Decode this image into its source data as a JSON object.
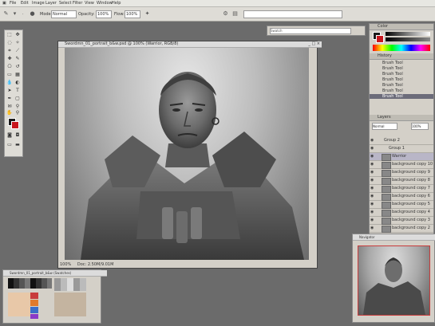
{
  "app": {
    "menu": [
      "File",
      "Edit",
      "Image",
      "Layer",
      "Select",
      "Filter",
      "View",
      "Window",
      "Help"
    ],
    "options": {
      "mode_label": "Mode:",
      "mode_value": "Normal",
      "opacity_label": "Opacity:",
      "opacity_value": "100%",
      "flow_label": "Flow:",
      "flow_value": "100%"
    },
    "colors": {
      "foreground": "#1a1a1a",
      "background": "#c8161d",
      "accent": "#c83c3c"
    }
  },
  "document": {
    "title": "Swordmn_01_portrait_b&w.psd @ 100% (Warrior, RGB/8)",
    "zoom": "100%",
    "status": "Doc: 2.50M/9.01M"
  },
  "panels": {
    "history_title": "History",
    "history_items": [
      "Brush Tool",
      "Brush Tool",
      "Brush Tool",
      "Brush Tool",
      "Brush Tool",
      "Brush Tool",
      "Brush Tool"
    ],
    "layers_title": "Layers",
    "blend_mode": "Normal",
    "opacity": "100%",
    "layer_groups": [
      "Group 2",
      "Group 1"
    ],
    "layers": [
      "Warrior",
      "background copy 10",
      "background copy 9",
      "background copy 8",
      "background copy 7",
      "background copy 6",
      "background copy 5",
      "background copy 4",
      "background copy 3",
      "background copy 2"
    ],
    "navigator_title": "Navigator",
    "swatches_title": "Swordmn_01_portrait_b&w (Swatches)",
    "search_placeholder": "Swatch"
  }
}
